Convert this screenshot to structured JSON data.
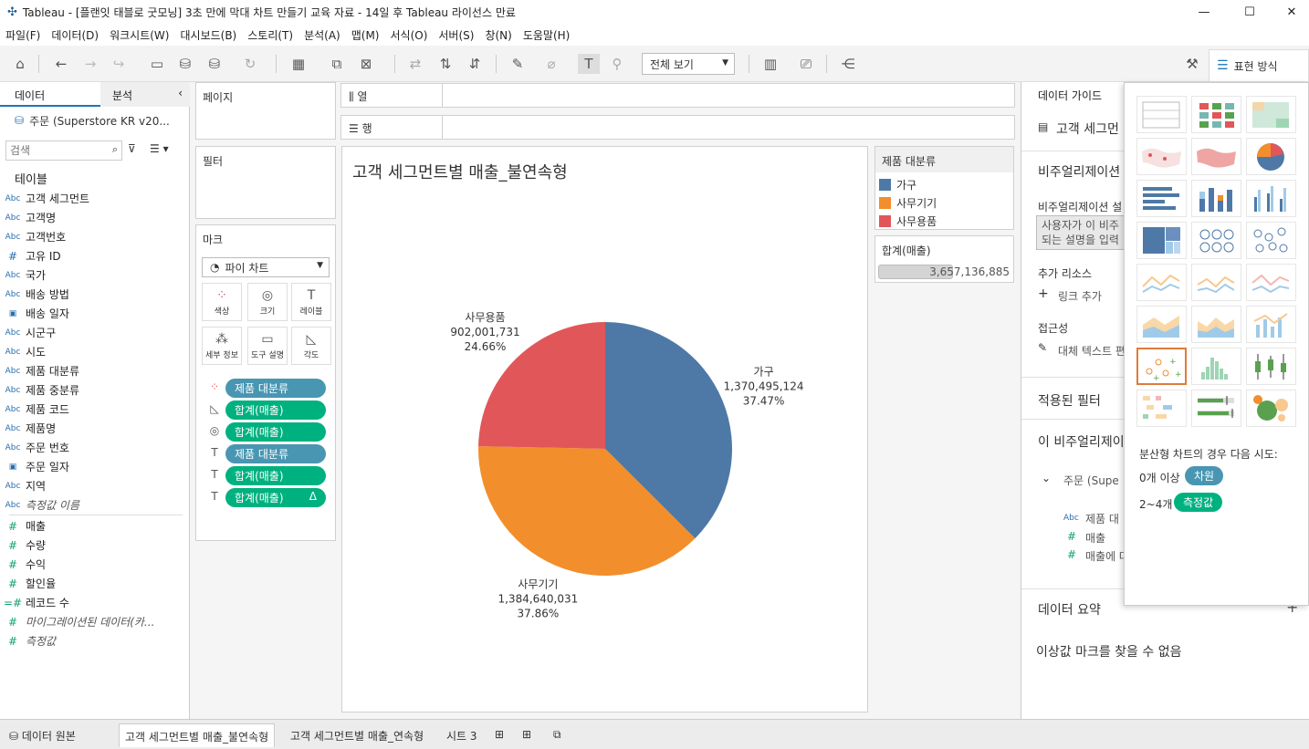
{
  "window": {
    "title": "Tableau - [플랜잇 태블로 굿모닝] 3초 만에 막대 차트 만들기 교육 자료 - 14일 후 Tableau 라이선스 만료"
  },
  "menu": [
    "파일(F)",
    "데이터(D)",
    "워크시트(W)",
    "대시보드(B)",
    "스토리(T)",
    "분석(A)",
    "맵(M)",
    "서식(O)",
    "서버(S)",
    "창(N)",
    "도움말(H)"
  ],
  "toolbar": {
    "view_select": "전체 보기",
    "show_me_label": "표현 방식"
  },
  "left_pane": {
    "tab_data": "데이터",
    "tab_analysis": "분석",
    "datasource": "주문 (Superstore KR v20...",
    "search_placeholder": "검색",
    "tables_header": "테이블",
    "fields": [
      {
        "type": "Abc",
        "name": "고객 세그먼트"
      },
      {
        "type": "Abc",
        "name": "고객명"
      },
      {
        "type": "Abc",
        "name": "고객번호"
      },
      {
        "type": "#",
        "name": "고유 ID"
      },
      {
        "type": "Abc",
        "name": "국가"
      },
      {
        "type": "Abc",
        "name": "배송 방법"
      },
      {
        "type": "date",
        "name": "배송 일자"
      },
      {
        "type": "Abc",
        "name": "시군구"
      },
      {
        "type": "Abc",
        "name": "시도"
      },
      {
        "type": "Abc",
        "name": "제품 대분류"
      },
      {
        "type": "Abc",
        "name": "제품 중분류"
      },
      {
        "type": "Abc",
        "name": "제품 코드"
      },
      {
        "type": "Abc",
        "name": "제품명"
      },
      {
        "type": "Abc",
        "name": "주문 번호"
      },
      {
        "type": "date",
        "name": "주문 일자"
      },
      {
        "type": "Abc",
        "name": "지역"
      },
      {
        "type": "Abc",
        "name": "측정값 이름",
        "italic": true
      }
    ],
    "measures": [
      {
        "type": "#",
        "name": "매출"
      },
      {
        "type": "#",
        "name": "수량"
      },
      {
        "type": "#",
        "name": "수익"
      },
      {
        "type": "#",
        "name": "할인율"
      },
      {
        "type": "=#",
        "name": "레코드 수"
      },
      {
        "type": "#",
        "name": "마이그레이션된 데이터(카...",
        "italic": true
      },
      {
        "type": "#",
        "name": "측정값",
        "italic": true
      }
    ]
  },
  "shelves": {
    "pages": "페이지",
    "filters": "필터",
    "marks": "마크",
    "mark_type": "파이 차트",
    "mark_buttons": [
      "색상",
      "크기",
      "레이블",
      "세부 정보",
      "도구 설명",
      "각도"
    ],
    "mark_pills": [
      {
        "label": "제품 대분류",
        "kind": "dim",
        "icon": "color"
      },
      {
        "label": "합계(매출)",
        "kind": "mea",
        "icon": "angle"
      },
      {
        "label": "합계(매출)",
        "kind": "mea",
        "icon": "size"
      },
      {
        "label": "제품 대분류",
        "kind": "dim",
        "icon": "label"
      },
      {
        "label": "합계(매출)",
        "kind": "mea",
        "icon": "label"
      },
      {
        "label": "합계(매출)",
        "kind": "mea",
        "icon": "label",
        "extra": "Δ"
      }
    ],
    "columns": "열",
    "rows": "행"
  },
  "viz": {
    "title": "고객 세그먼트별 매출_불연속형"
  },
  "chart_data": {
    "type": "pie",
    "categories": [
      "가구",
      "사무기기",
      "사무용품"
    ],
    "values": [
      1370495124,
      1384640031,
      902001731
    ],
    "value_labels": [
      "1,370,495,124",
      "1,384,640,031",
      "902,001,731"
    ],
    "percent_labels": [
      "37.47%",
      "37.86%",
      "24.66%"
    ],
    "colors": [
      "#4e79a7",
      "#f28e2b",
      "#e15759"
    ]
  },
  "legend": {
    "title": "제품 대분류",
    "items": [
      {
        "label": "가구",
        "color": "#4e79a7"
      },
      {
        "label": "사무기기",
        "color": "#f28e2b"
      },
      {
        "label": "사무용품",
        "color": "#e15759"
      }
    ]
  },
  "size_legend": {
    "title": "합계(매출)",
    "value": "3,657,136,885"
  },
  "right_pane": {
    "title": "데이터 가이드",
    "sheet": "고객 세그먼",
    "viz_desc_header": "비주얼리제이션",
    "viz_desc_label": "비주얼리제이션 설",
    "viz_desc_placeholder_1": "사용자가 이 비주",
    "viz_desc_placeholder_2": "되는 설명을 입력",
    "resources": "추가 리소스",
    "add_link": "링크 추가",
    "accessibility": "접근성",
    "alt_text": "대체 텍스트 편",
    "applied_filters": "적용된 필터",
    "this_viz": "이 비주얼리제이",
    "source": "주문 (Supe",
    "src_fields": [
      "제품 대",
      "매출",
      "매출에 대"
    ],
    "data_summary": "데이터 요약",
    "no_outliers": "이상값 마크를 찾을 수 없음"
  },
  "show_me": {
    "hint": "분산형 차트의 경우 다음 시도:",
    "dim_req": "0개 이상",
    "dim_pill": "차원",
    "mea_req": "2~4개",
    "mea_pill": "측정값"
  },
  "bottom": {
    "datasource_tab": "데이터 원본",
    "sheets": [
      "고객 세그먼트별 매출_불연속형",
      "고객 세그먼트별 매출_연속형",
      "시트 3"
    ]
  }
}
